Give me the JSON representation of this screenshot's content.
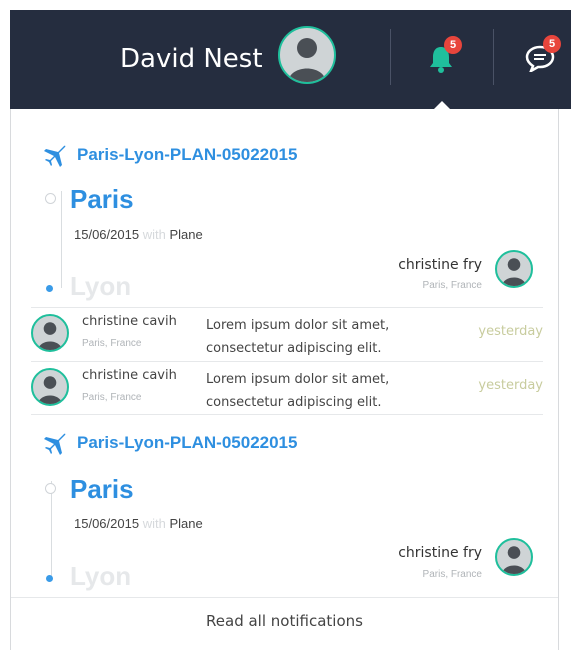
{
  "header": {
    "user_name": "David Nest",
    "notifications_count": "5",
    "messages_count": "5",
    "colors": {
      "bar": "#252d3f",
      "bell": "#1fbf9c",
      "badge": "#e8453c"
    }
  },
  "trips": [
    {
      "title": "Paris-Lyon-PLAN-05022015",
      "from": "Paris",
      "to": "Lyon",
      "date": "15/06/2015",
      "with_word": "with",
      "mode": "Plane",
      "traveler": {
        "name": "christine fry",
        "location": "Paris, France"
      }
    },
    {
      "title": "Paris-Lyon-PLAN-05022015",
      "from": "Paris",
      "to": "Lyon",
      "date": "15/06/2015",
      "with_word": "with",
      "mode": "Plane",
      "traveler": {
        "name": "christine fry",
        "location": "Paris, France"
      }
    }
  ],
  "notifications": [
    {
      "name": "christine cavih",
      "location": "Paris, France",
      "message": "Lorem ipsum dolor sit amet, consectetur adipiscing elit.",
      "time": "yesterday"
    },
    {
      "name": "christine cavih",
      "location": "Paris, France",
      "message": "Lorem ipsum dolor sit amet, consectetur adipiscing elit.",
      "time": "yesterday"
    }
  ],
  "footer": {
    "read_all": "Read all notifications"
  }
}
